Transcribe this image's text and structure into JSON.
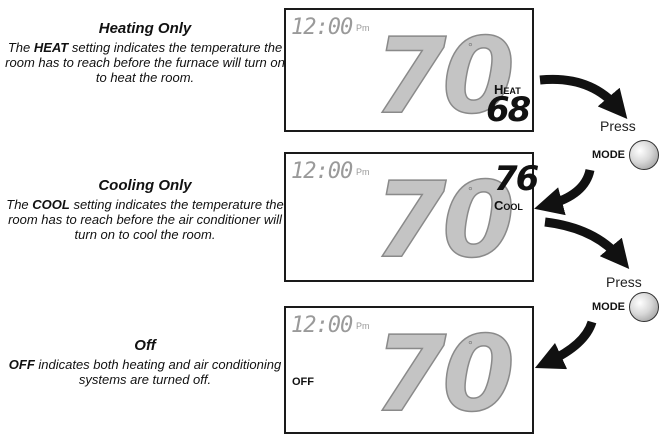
{
  "sections": [
    {
      "title": "Heating Only",
      "text_before": "The ",
      "keyword": "HEAT",
      "text_after": " setting indicates the temperature the room has to reach before the furnace will turn on to heat the room."
    },
    {
      "title": "Cooling Only",
      "text_before": "The ",
      "keyword": "COOL",
      "text_after": " setting indicates the temperature the room has to reach before the air conditioner will turn on to cool the room."
    },
    {
      "title": "Off",
      "text_before": "",
      "keyword": "OFF",
      "text_after": " indicates both heating and air conditioning systems are turned off."
    }
  ],
  "displays": [
    {
      "clock": "12:00",
      "ampm": "Pm",
      "temperature": "70",
      "degree": "°",
      "mode_label": "Heat",
      "setpoint": "68"
    },
    {
      "clock": "12:00",
      "ampm": "Pm",
      "temperature": "70",
      "degree": "°",
      "mode_label": "Cool",
      "setpoint": "76"
    },
    {
      "clock": "12:00",
      "ampm": "Pm",
      "temperature": "70",
      "degree": "°",
      "mode_label": "OFF",
      "setpoint": ""
    }
  ],
  "press_label": "Press",
  "mode_button_label": "MODE",
  "colors": {
    "lcd_segment": "#c4c4c4",
    "lcd_outline": "#8a8a8a",
    "ink": "#111111"
  }
}
